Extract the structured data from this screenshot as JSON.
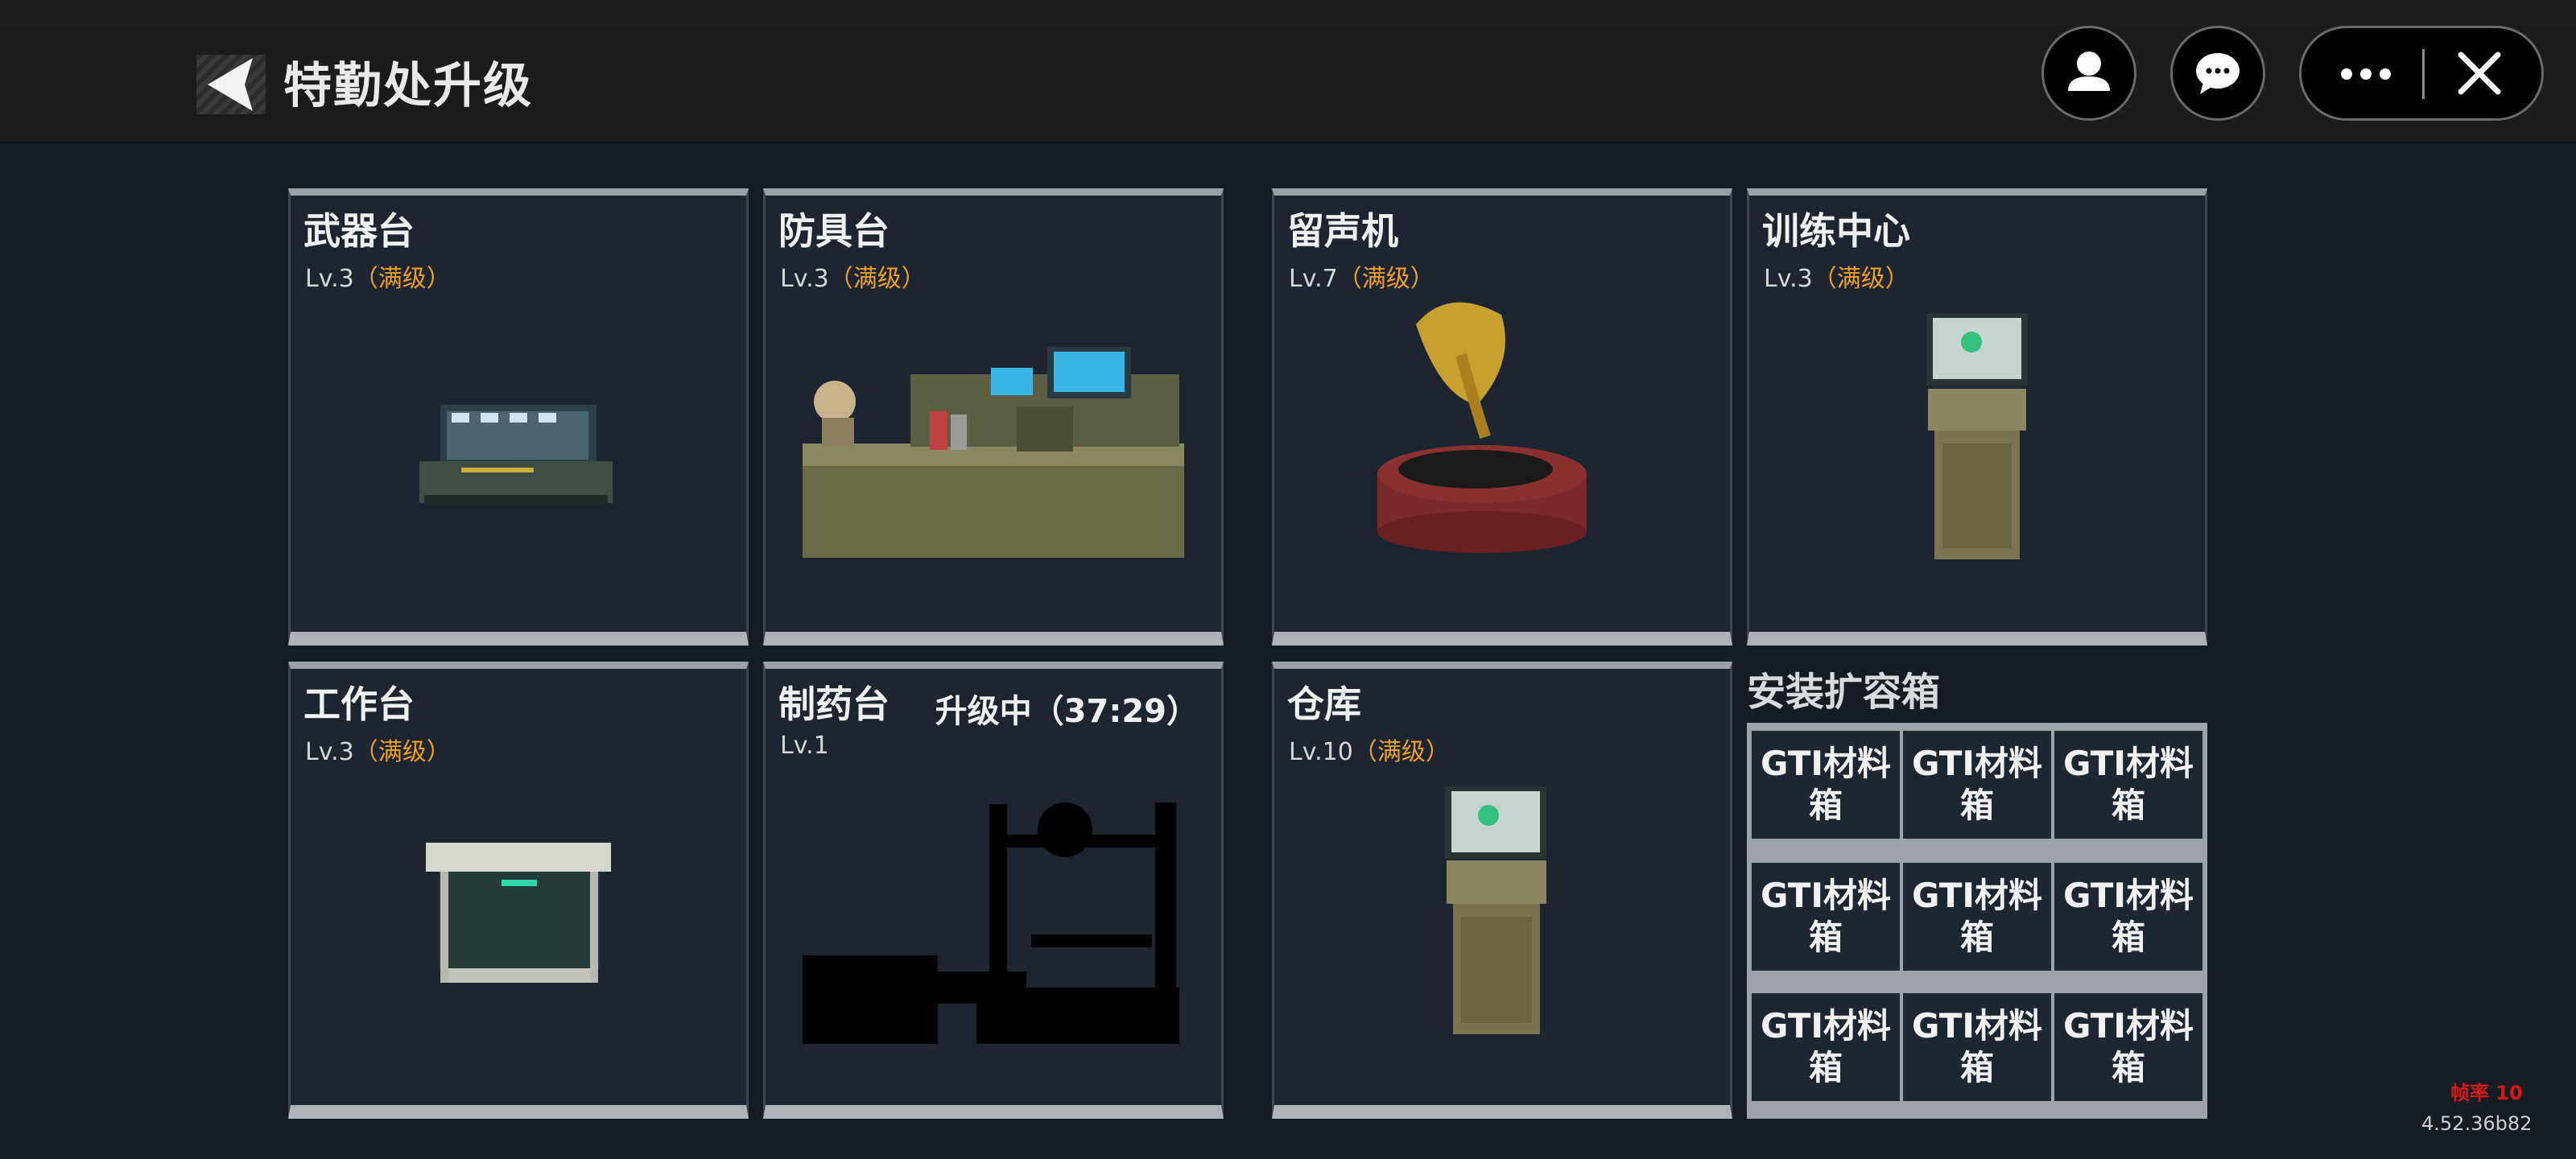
{
  "header": {
    "title": "特勤处升级",
    "icons": [
      "back-arrow-icon",
      "user-icon",
      "chat-icon",
      "more-icon",
      "close-icon"
    ]
  },
  "stations": [
    {
      "name": "武器台",
      "level": "Lv.3",
      "max": "（满级）",
      "status": ""
    },
    {
      "name": "防具台",
      "level": "Lv.3",
      "max": "（满级）",
      "status": ""
    },
    {
      "name": "留声机",
      "level": "Lv.7",
      "max": "（满级）",
      "status": ""
    },
    {
      "name": "训练中心",
      "level": "Lv.3",
      "max": "（满级）",
      "status": ""
    },
    {
      "name": "工作台",
      "level": "Lv.3",
      "max": "（满级）",
      "status": ""
    },
    {
      "name": "制药台",
      "level": "Lv.1",
      "max": "",
      "status": "升级中（37:29）"
    },
    {
      "name": "仓库",
      "level": "Lv.10",
      "max": "（满级）",
      "status": ""
    }
  ],
  "expansion": {
    "title": "安装扩容箱",
    "boxes": [
      "GTI材料箱",
      "GTI材料箱",
      "GTI材料箱",
      "GTI材料箱",
      "GTI材料箱",
      "GTI材料箱",
      "GTI材料箱",
      "GTI材料箱",
      "GTI材料箱"
    ]
  },
  "overlay": {
    "fps": "帧率 10",
    "version": "4.52.36b82"
  },
  "colors": {
    "background": "#141c24",
    "card": "#1c2530",
    "max_level": "#f0a020",
    "fps": "#d81818"
  }
}
